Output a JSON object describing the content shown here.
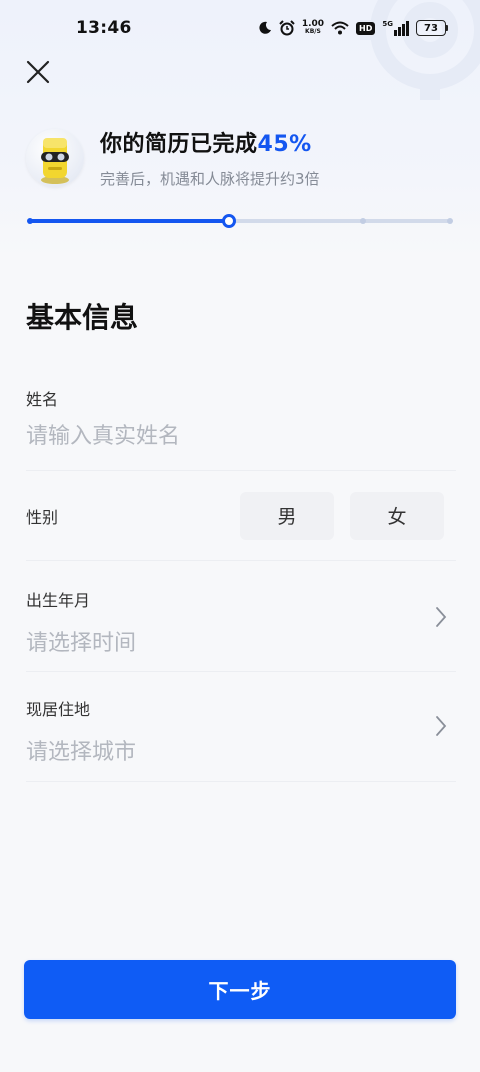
{
  "status_bar": {
    "time": "13:46",
    "net_speed_value": "1.00",
    "net_speed_unit": "KB/S",
    "hd": "HD",
    "signal": "5G",
    "battery": "73",
    "icons": [
      "moon-icon",
      "alarm-icon",
      "wifi-icon",
      "signal-icon",
      "battery-icon"
    ]
  },
  "header": {
    "title_prefix": "你的简历已完成",
    "percent": "45%",
    "subtitle": "完善后，机遇和人脉将提升约3倍"
  },
  "progress": {
    "completion": 0.45,
    "accent_color": "#1456f0",
    "track_color": "#d2daea"
  },
  "section": {
    "title": "基本信息"
  },
  "form": {
    "name": {
      "label": "姓名",
      "placeholder": "请输入真实姓名"
    },
    "gender": {
      "label": "性别",
      "options": [
        "男",
        "女"
      ]
    },
    "birth": {
      "label": "出生年月",
      "placeholder": "请选择时间"
    },
    "residence": {
      "label": "现居住地",
      "placeholder": "请选择城市"
    }
  },
  "actions": {
    "next_label": "下一步",
    "button_color": "#0f5cf5"
  }
}
